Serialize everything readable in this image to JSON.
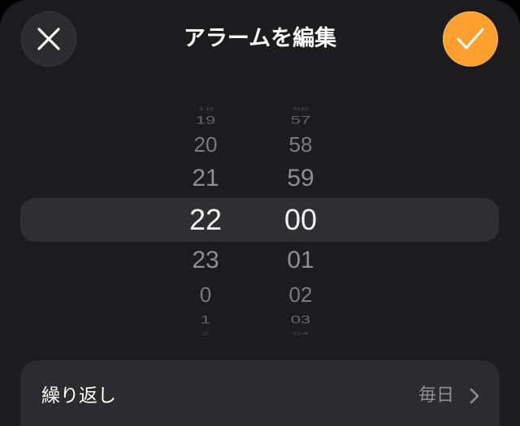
{
  "header": {
    "title": "アラームを編集",
    "close_icon": "close-icon",
    "save_icon": "checkmark-icon",
    "accent_color": "#ff9f30"
  },
  "time_picker": {
    "hours": [
      "18",
      "19",
      "20",
      "21",
      "22",
      "23",
      "0",
      "1",
      "2"
    ],
    "minutes": [
      "56",
      "57",
      "58",
      "59",
      "00",
      "01",
      "02",
      "03",
      "04"
    ],
    "selected_hour": "22",
    "selected_minute": "00"
  },
  "repeat": {
    "label": "繰り返し",
    "value": "毎日",
    "chevron_icon": "chevron-right-icon"
  }
}
